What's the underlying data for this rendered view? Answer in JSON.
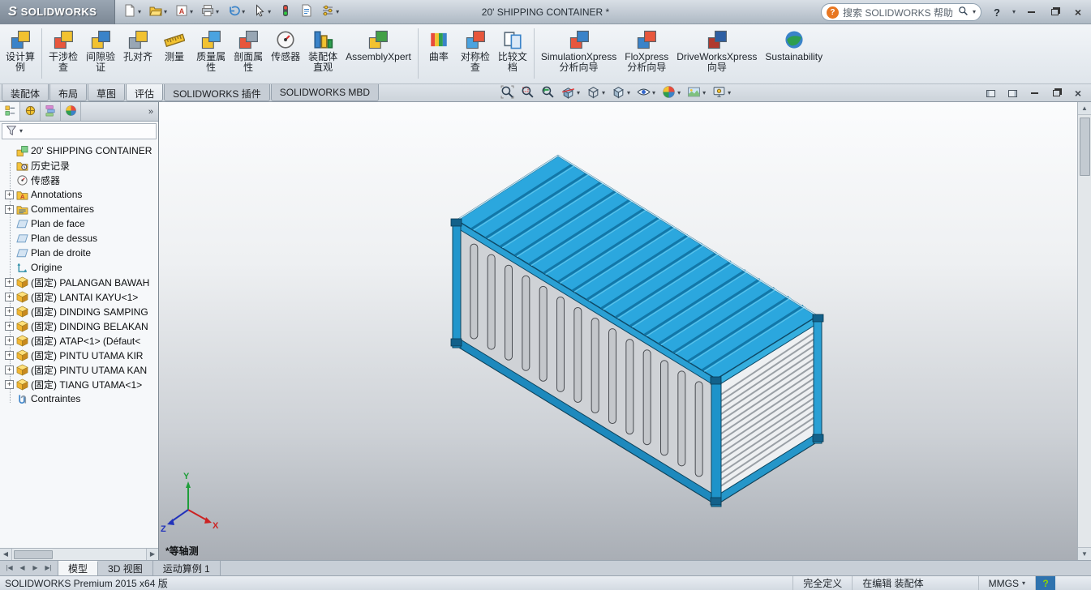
{
  "titlebar": {
    "brand": "SOLIDWORKS",
    "title": "20' SHIPPING CONTAINER *",
    "search_placeholder": "搜索 SOLIDWORKS 帮助"
  },
  "quick_access": [
    {
      "name": "new-document",
      "dropdown": true
    },
    {
      "name": "open",
      "dropdown": true
    },
    {
      "name": "make-drawing",
      "dropdown": true
    },
    {
      "name": "print",
      "dropdown": true
    },
    {
      "name": "undo",
      "dropdown": true
    },
    {
      "name": "select",
      "dropdown": true
    },
    {
      "name": "rebuild",
      "dropdown": false
    },
    {
      "name": "file-properties",
      "dropdown": false
    },
    {
      "name": "options",
      "dropdown": true
    }
  ],
  "ribbon": {
    "items": [
      {
        "icon": "design-study-icon",
        "lines": [
          "设计算",
          "例"
        ],
        "sep_after": true
      },
      {
        "icon": "interference-detection-icon",
        "lines": [
          "干涉检",
          "查"
        ]
      },
      {
        "icon": "clearance-verification-icon",
        "lines": [
          "间隙验",
          "证"
        ]
      },
      {
        "icon": "hole-alignment-icon",
        "lines": [
          "孔对齐"
        ]
      },
      {
        "icon": "measure-icon",
        "lines": [
          "测量"
        ]
      },
      {
        "icon": "mass-properties-icon",
        "lines": [
          "质量属",
          "性"
        ]
      },
      {
        "icon": "section-properties-icon",
        "lines": [
          "剖面属",
          "性"
        ]
      },
      {
        "icon": "sensor-icon",
        "lines": [
          "传感器"
        ]
      },
      {
        "icon": "assembly-visualization-icon",
        "lines": [
          "装配体",
          "直观"
        ]
      },
      {
        "icon": "assemblyxpert-icon",
        "lines": [
          "AssemblyXpert"
        ],
        "sep_after": true
      },
      {
        "icon": "curvature-icon",
        "lines": [
          "曲率"
        ]
      },
      {
        "icon": "symmetry-check-icon",
        "lines": [
          "对称检",
          "查"
        ]
      },
      {
        "icon": "compare-documents-icon",
        "lines": [
          "比较文",
          "档"
        ],
        "sep_after": true
      },
      {
        "icon": "simulationxpress-icon",
        "lines": [
          "SimulationXpress",
          "分析向导"
        ]
      },
      {
        "icon": "floxpress-icon",
        "lines": [
          "FloXpress",
          "分析向导"
        ]
      },
      {
        "icon": "driveworksxpress-icon",
        "lines": [
          "DriveWorksXpress",
          "向导"
        ]
      },
      {
        "icon": "sustainability-icon",
        "lines": [
          "Sustainability"
        ]
      }
    ]
  },
  "command_tabs": [
    {
      "name": "assembly",
      "label": "装配体",
      "style": "raised",
      "active": false
    },
    {
      "name": "layout",
      "label": "布局",
      "style": "raised",
      "active": false
    },
    {
      "name": "sketch",
      "label": "草图",
      "style": "raised",
      "active": false
    },
    {
      "name": "evaluate",
      "label": "评估",
      "style": "active",
      "active": true
    },
    {
      "name": "solidworks-addins",
      "label": "SOLIDWORKS 插件",
      "style": "flat",
      "active": false
    },
    {
      "name": "solidworks-mbd",
      "label": "SOLIDWORKS MBD",
      "style": "flat",
      "active": false
    }
  ],
  "view_toolbar": [
    {
      "icon": "zoom-fit-icon",
      "dropdown": false
    },
    {
      "icon": "zoom-area-icon",
      "dropdown": false
    },
    {
      "icon": "previous-view-icon",
      "dropdown": false
    },
    {
      "icon": "section-view-icon",
      "dropdown": true
    },
    {
      "icon": "view-orientation-icon",
      "dropdown": true
    },
    {
      "icon": "display-style-icon",
      "dropdown": true
    },
    {
      "icon": "hide-show-items-icon",
      "dropdown": true
    },
    {
      "icon": "edit-appearance-icon",
      "dropdown": true
    },
    {
      "icon": "apply-scene-icon",
      "dropdown": true
    },
    {
      "icon": "view-settings-icon",
      "dropdown": true
    }
  ],
  "panel_tabs": [
    {
      "icon": "featuremanager-icon",
      "name": "feature-manager",
      "active": true
    },
    {
      "icon": "propertymanager-icon",
      "name": "property-manager",
      "active": false
    },
    {
      "icon": "configurationmanager-icon",
      "name": "configuration-manager",
      "active": false
    },
    {
      "icon": "displaymanager-icon",
      "name": "display-manager",
      "active": false
    }
  ],
  "feature_tree": {
    "items": [
      {
        "icon": "assembly-icon",
        "label": "20' SHIPPING CONTAINER",
        "expand": null
      },
      {
        "icon": "history-icon",
        "label": "历史记录",
        "expand": null
      },
      {
        "icon": "sensors-icon",
        "label": "传感器",
        "expand": null
      },
      {
        "icon": "annotations-icon",
        "label": "Annotations",
        "expand": "+"
      },
      {
        "icon": "comments-icon",
        "label": "Commentaires",
        "expand": "+"
      },
      {
        "icon": "plane-icon",
        "label": "Plan de face",
        "expand": null
      },
      {
        "icon": "plane-icon",
        "label": "Plan de dessus",
        "expand": null
      },
      {
        "icon": "plane-icon",
        "label": "Plan de droite",
        "expand": null
      },
      {
        "icon": "origin-icon",
        "label": "Origine",
        "expand": null
      },
      {
        "icon": "part-icon",
        "label": "(固定) PALANGAN BAWAH",
        "expand": "+"
      },
      {
        "icon": "part-icon",
        "label": "(固定) LANTAI KAYU<1>",
        "expand": "+"
      },
      {
        "icon": "part-icon",
        "label": "(固定) DINDING SAMPING",
        "expand": "+"
      },
      {
        "icon": "part-icon",
        "label": "(固定) DINDING BELAKAN",
        "expand": "+"
      },
      {
        "icon": "part-icon",
        "label": "(固定) ATAP<1> (Défaut<",
        "expand": "+"
      },
      {
        "icon": "part-icon",
        "label": "(固定) PINTU UTAMA KIR",
        "expand": "+"
      },
      {
        "icon": "part-icon",
        "label": "(固定) PINTU UTAMA KAN",
        "expand": "+"
      },
      {
        "icon": "part-icon",
        "label": "(固定) TIANG UTAMA<1>",
        "expand": "+"
      },
      {
        "icon": "mates-icon",
        "label": "Contraintes",
        "expand": null
      }
    ]
  },
  "viewport": {
    "view_label": "*等轴测",
    "triad_labels": {
      "x": "X",
      "y": "Y",
      "z": "Z"
    }
  },
  "document_tabs": [
    {
      "name": "model",
      "label": "模型",
      "active": true
    },
    {
      "name": "3d-views",
      "label": "3D 视图",
      "active": false
    },
    {
      "name": "motion-study-1",
      "label": "运动算例 1",
      "active": false
    }
  ],
  "statusbar": {
    "product": "SOLIDWORKS Premium 2015 x64 版",
    "definition_status": "完全定义",
    "editing_status": "在编辑 装配体",
    "units": "MMGS"
  }
}
